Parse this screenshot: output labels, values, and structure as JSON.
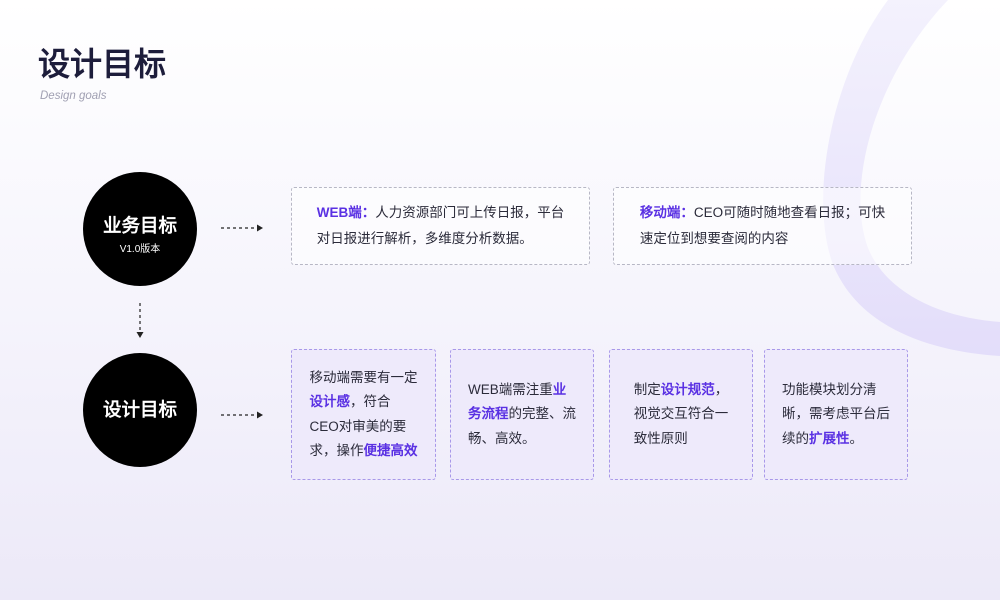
{
  "theme": {
    "accent": "#5a31e3",
    "title_color": "#1d1d3b",
    "stage_fill": "#000000",
    "stage_text": "#ffffff"
  },
  "header": {
    "title": "设计目标",
    "subtitle": "Design goals"
  },
  "stages": [
    {
      "title": "业务目标",
      "version": "V1.0版本"
    },
    {
      "title": "设计目标"
    }
  ],
  "business_goals": [
    {
      "lines": [
        [
          {
            "text": "WEB端：",
            "emphasis": true
          },
          {
            "text": "人力资源部门可上传日报，平台"
          }
        ],
        [
          {
            "text": "对日报进行解析，多维度分析数据。"
          }
        ]
      ]
    },
    {
      "lines": [
        [
          {
            "text": "移动端：",
            "emphasis": true
          },
          {
            "text": "CEO可随时随地查看日报；可快"
          }
        ],
        [
          {
            "text": "速定位到想要查阅的内容"
          }
        ]
      ]
    }
  ],
  "design_goals": [
    {
      "lines": [
        [
          {
            "text": "移动端需要有一定"
          }
        ],
        [
          {
            "text": "设计感",
            "emphasis": true
          },
          {
            "text": "，符合"
          }
        ],
        [
          {
            "text": "CEO对审美的要"
          }
        ],
        [
          {
            "text": "求，操作"
          },
          {
            "text": "便捷高效",
            "emphasis": true
          }
        ]
      ]
    },
    {
      "lines": [
        [
          {
            "text": "WEB端需注重"
          },
          {
            "text": "业",
            "emphasis": true
          }
        ],
        [
          {
            "text": "务流程",
            "emphasis": true
          },
          {
            "text": "的完整、流"
          }
        ],
        [
          {
            "text": "畅、高效。"
          }
        ]
      ]
    },
    {
      "lines": [
        [
          {
            "text": "制定"
          },
          {
            "text": "设计规范",
            "emphasis": true
          },
          {
            "text": "，"
          }
        ],
        [
          {
            "text": "视觉交互符合一"
          }
        ],
        [
          {
            "text": "致性原则"
          }
        ]
      ]
    },
    {
      "lines": [
        [
          {
            "text": "功能模块划分清"
          }
        ],
        [
          {
            "text": "晰，需考虑平台后"
          }
        ],
        [
          {
            "text": "续的"
          },
          {
            "text": "扩展性",
            "emphasis": true
          },
          {
            "text": "。"
          }
        ]
      ]
    }
  ]
}
